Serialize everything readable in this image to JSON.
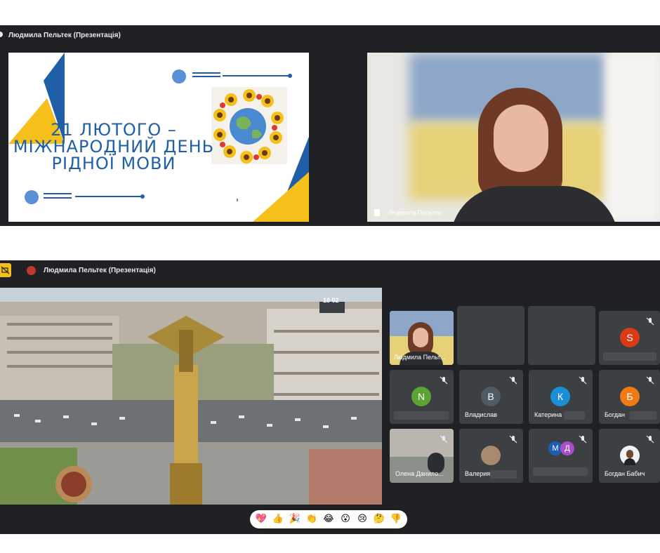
{
  "top_window": {
    "title": "Людмила Пельтек (Презентація)",
    "slide": {
      "title_lines": [
        "21 ЛЮТОГО –",
        "МІЖНАРОДНИЙ ДЕНЬ",
        "РІДНОЇ МОВИ"
      ]
    },
    "speaker_tile": {
      "name": "Людмила Пельтек"
    }
  },
  "bottom_window": {
    "title": "Людмила Пельтек (Презентація)",
    "video": {
      "clock_text": "18 02"
    },
    "participants": [
      {
        "initial": "",
        "name": "Людмила Пельт...",
        "color": ""
      },
      {
        "initial": "S",
        "name": "",
        "color": "#d93b16"
      },
      {
        "initial": "N",
        "name": "",
        "color": "#5ba332"
      },
      {
        "initial": "В",
        "name": "Владислав",
        "color": "#4f5b66"
      },
      {
        "initial": "К",
        "name": "Катерина",
        "color": "#1a8fd6"
      },
      {
        "initial": "Б",
        "name": "Богдан",
        "color": "#f07a14"
      },
      {
        "initial": "",
        "name": "Олена Данило...",
        "color": ""
      },
      {
        "initial": "",
        "name": "Валерия",
        "color": ""
      },
      {
        "initial": "М",
        "name": "",
        "color": "#1d5fb4"
      },
      {
        "initial": "Д",
        "name": "",
        "color": "#a84fc4"
      },
      {
        "initial": "",
        "name": "Богдан Бабич",
        "color": ""
      }
    ],
    "reactions": [
      "💖",
      "👍",
      "🎉",
      "👏",
      "😂",
      "😮",
      "😢",
      "🤔",
      "👎"
    ]
  }
}
